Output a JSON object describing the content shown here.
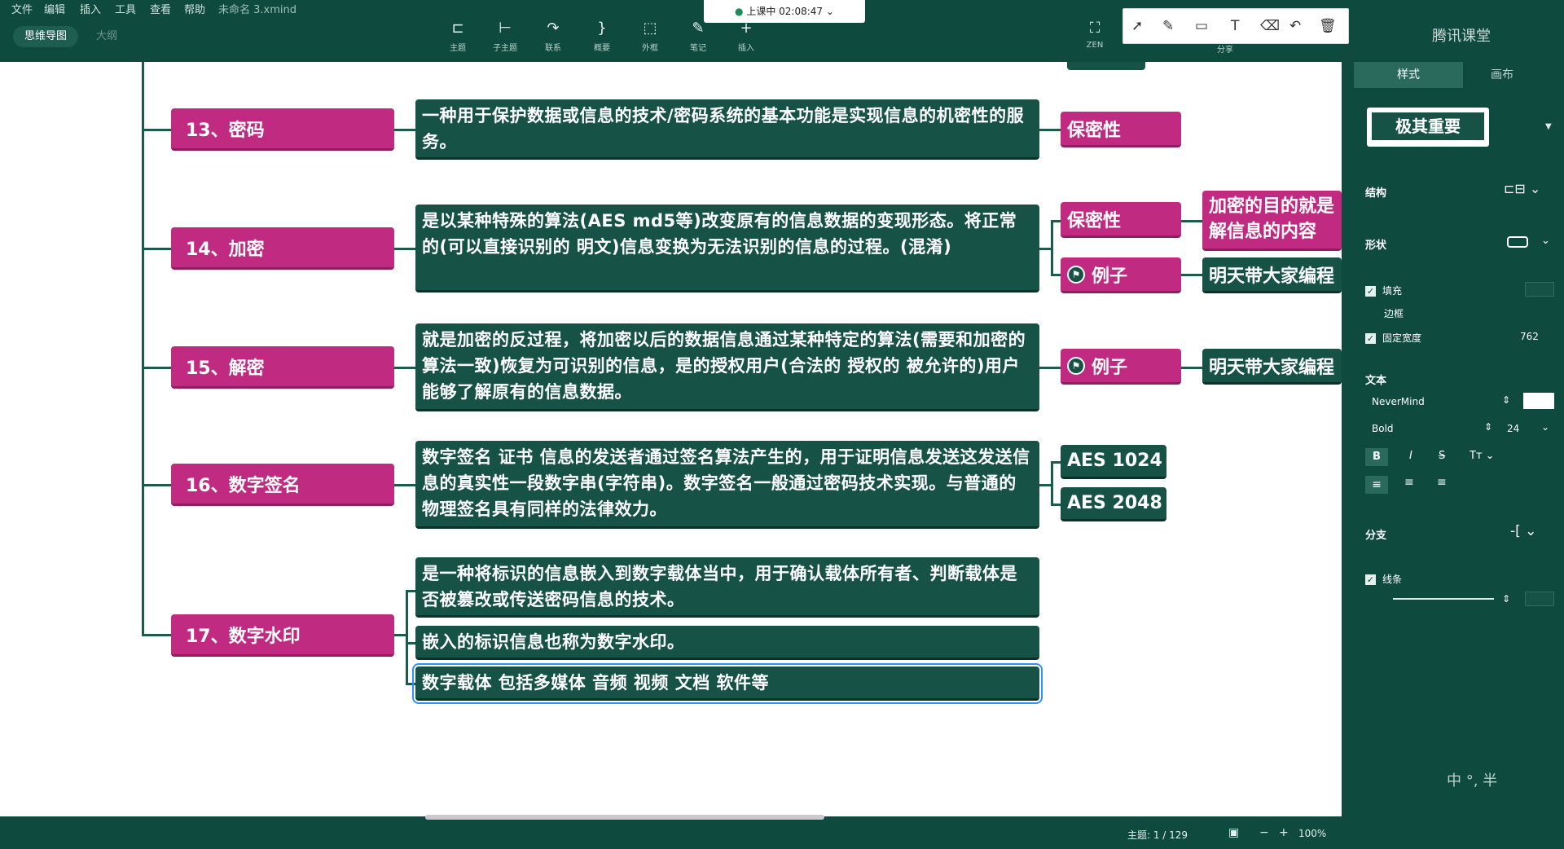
{
  "menubar": {
    "items": [
      "文件",
      "编辑",
      "插入",
      "工具",
      "查看",
      "帮助"
    ],
    "filename": "未命名 3.xmind"
  },
  "view_tabs": {
    "mindmap": "思维导图",
    "outline": "大纲"
  },
  "timer": "上课中 02:08:47",
  "toolbar": [
    {
      "icon": "topic-icon",
      "label": "主题"
    },
    {
      "icon": "subtopic-icon",
      "label": "子主题"
    },
    {
      "icon": "relationship-icon",
      "label": "联系"
    },
    {
      "icon": "summary-icon",
      "label": "概要"
    },
    {
      "icon": "boundary-icon",
      "label": "外框"
    },
    {
      "icon": "note-icon",
      "label": "笔记"
    },
    {
      "icon": "insert-icon",
      "label": "插入"
    }
  ],
  "zen_label": "ZEN",
  "share_label": "分享",
  "brand": "腾讯课堂",
  "nodes": [
    {
      "title": "13、密码",
      "desc": "一种用于保护数据或信息的技术/密码系统的基本功能是实现信息的机密性的服务。",
      "tags": [
        "保密性"
      ]
    },
    {
      "title": "14、加密",
      "desc": "是以某种特殊的算法(AES md5等)改变原有的信息数据的变现形态。将正常的(可以直接识别的 明文)信息变换为无法识别的信息的过程。(混淆)",
      "tags": [
        "保密性",
        "例子"
      ],
      "extra": [
        "加密的目的就是解信息的内容",
        "明天带大家编程"
      ]
    },
    {
      "title": "15、解密",
      "desc": "就是加密的反过程，将加密以后的数据信息通过某种特定的算法(需要和加密的算法一致)恢复为可识别的信息，是的授权用户(合法的 授权的 被允许的)用户能够了解原有的信息数据。",
      "tags": [
        "例子"
      ],
      "extra": [
        "明天带大家编程"
      ]
    },
    {
      "title": "16、数字签名",
      "desc": "数字签名 证书 信息的发送者通过签名算法产生的，用于证明信息发送这发送信息的真实性一段数字串(字符串)。数字签名一般通过密码技术实现。与普通的物理签名具有同样的法律效力。",
      "tags": [
        "AES 1024",
        "AES 2048"
      ]
    },
    {
      "title": "17、数字水印",
      "descs": [
        "是一种将标识的信息嵌入到数字载体当中，用于确认载体所有者、判断载体是否被篡改或传送密码信息的技术。",
        "嵌入的标识信息也称为数字水印。",
        "数字载体 包括多媒体 音频 视频 文档 软件等"
      ]
    }
  ],
  "panel": {
    "tab_style": "样式",
    "tab_canvas": "画布",
    "style_preview": "极其重要",
    "structure": "结构",
    "shape": "形状",
    "fill": "填充",
    "border": "边框",
    "fixed_width": "固定宽度",
    "fixed_width_value": "762",
    "text": "文本",
    "font": "NeverMind",
    "weight": "Bold",
    "size": "24",
    "branch": "分支",
    "line": "线条",
    "ime": "中 °, 半"
  },
  "status": {
    "topics": "主题: 1 / 129",
    "zoom": "100%"
  },
  "colors": {
    "chrome": "#0f4a3f",
    "topic": "#c02a80",
    "desc": "#175246"
  }
}
